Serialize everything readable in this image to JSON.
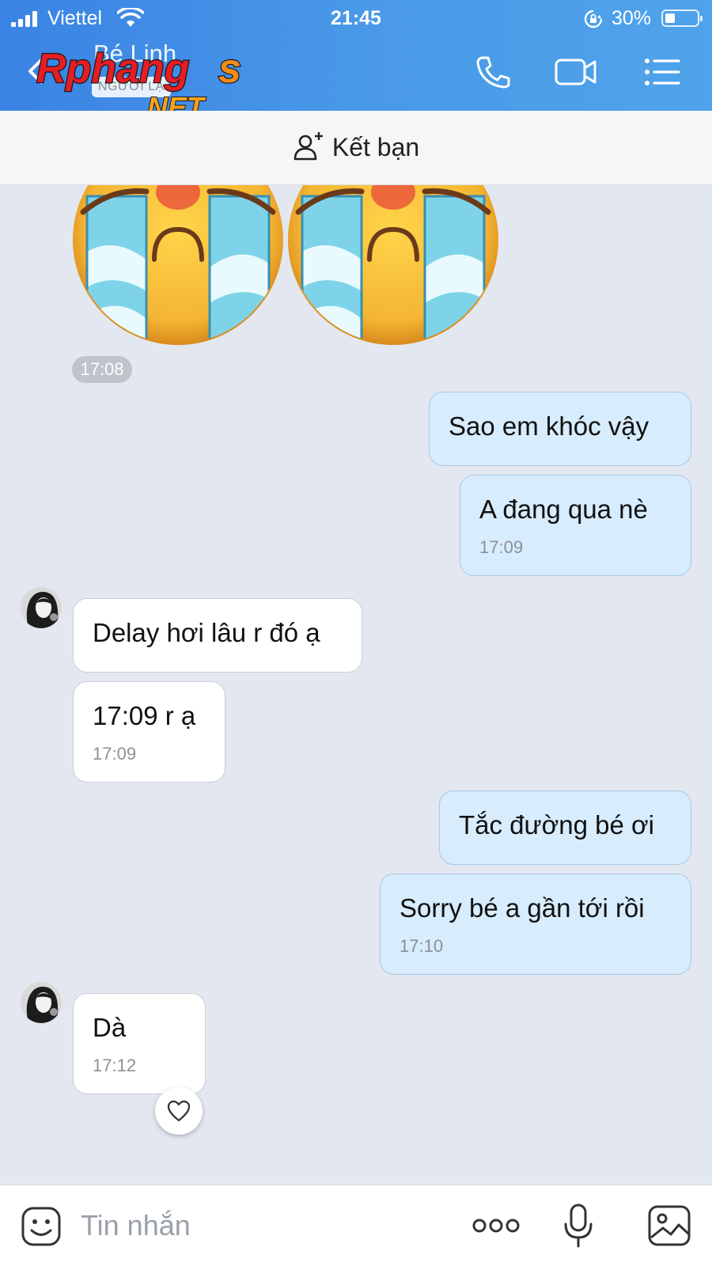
{
  "status_bar": {
    "carrier": "Viettel",
    "time": "21:45",
    "battery": "30%"
  },
  "header": {
    "contact_name": "Bé Linh",
    "stranger_label": "NGƯỜI LẠ",
    "watermark_text": "Rphangs .NET",
    "icons": [
      "back-arrow-icon",
      "phone-icon",
      "video-call-icon",
      "menu-list-icon"
    ]
  },
  "friend_bar": {
    "label": "Kết bạn",
    "icon": "add-friend-icon"
  },
  "chat": {
    "sticker_timestamp": "17:08",
    "messages": [
      {
        "sender": "me",
        "text": "Sao em khóc vậy"
      },
      {
        "sender": "me",
        "text": "A đang qua nè",
        "time": "17:09"
      },
      {
        "sender": "them",
        "text": "Delay hơi lâu r đó ạ"
      },
      {
        "sender": "them",
        "text": "17:09 r ạ",
        "time": "17:09"
      },
      {
        "sender": "me",
        "text": "Tắc đường bé ơi"
      },
      {
        "sender": "me",
        "text": "Sorry bé a gần tới rồi",
        "time": "17:10"
      },
      {
        "sender": "them",
        "text": "Dà",
        "time": "17:12"
      }
    ]
  },
  "input_bar": {
    "placeholder": "Tin nhắn",
    "icons": [
      "emoji-icon",
      "more-icon",
      "microphone-icon",
      "image-icon"
    ]
  },
  "colors": {
    "header_blue": "#3a83e4",
    "my_bubble": "#d7ecfc",
    "their_bubble": "#ffffff",
    "chat_background": "#e3e7ef"
  }
}
